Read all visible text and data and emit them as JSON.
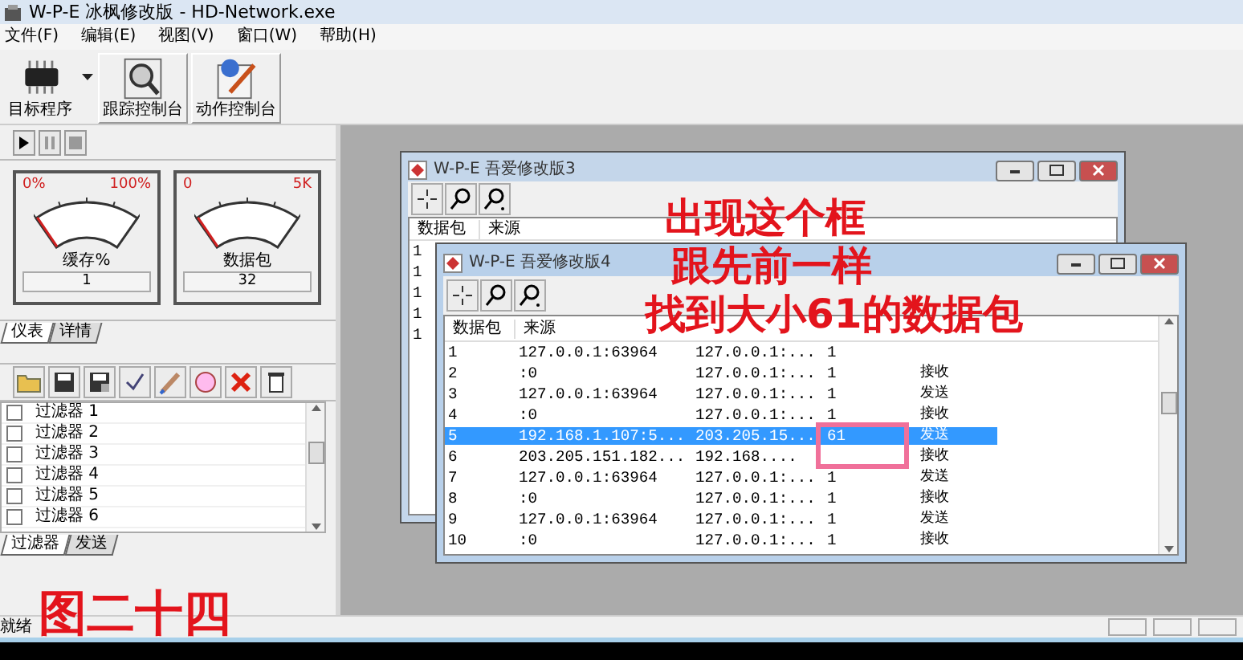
{
  "window": {
    "title": "W-P-E 冰枫修改版 - HD-Network.exe"
  },
  "menu": [
    "文件(F)",
    "编辑(E)",
    "视图(V)",
    "窗口(W)",
    "帮助(H)"
  ],
  "toolbar": [
    {
      "label": "目标程序",
      "kind": "target"
    },
    {
      "label": "跟踪控制台",
      "kind": "trace"
    },
    {
      "label": "动作控制台",
      "kind": "action"
    }
  ],
  "left_panel": {
    "gauges": [
      {
        "min_label": "0%",
        "max_label": "100%",
        "title": "缓存%",
        "value": "1"
      },
      {
        "min_label": "0",
        "max_label": "5K",
        "title": "数据包",
        "value": "32"
      }
    ],
    "gauge_tabs": [
      {
        "label": "仪表",
        "selected": true
      },
      {
        "label": "详情",
        "selected": false
      }
    ],
    "filters": [
      {
        "label": "过滤器 1",
        "checked": false
      },
      {
        "label": "过滤器 2",
        "checked": false
      },
      {
        "label": "过滤器 3",
        "checked": false
      },
      {
        "label": "过滤器 4",
        "checked": false
      },
      {
        "label": "过滤器 5",
        "checked": false
      },
      {
        "label": "过滤器 6",
        "checked": false
      }
    ],
    "filter_tabs": [
      {
        "label": "过滤器",
        "selected": true
      },
      {
        "label": "发送",
        "selected": false
      }
    ]
  },
  "windows": [
    {
      "title": "W-P-E 吾爱修改版3",
      "columns": [
        "数据包",
        "来源"
      ],
      "rows": [
        {
          "number": "1"
        },
        {
          "number": "1"
        },
        {
          "number": "1"
        },
        {
          "number": "1"
        },
        {
          "number": "1"
        }
      ]
    },
    {
      "title": "W-P-E 吾爱修改版4",
      "columns": [
        "数据包",
        "来源"
      ],
      "rows": [
        {
          "number": "1",
          "source": "127.0.0.1:63964",
          "target": "127.0.0.1:...",
          "size": "1",
          "selected": false
        },
        {
          "number": "2",
          "source": ":0",
          "target": "127.0.0.1:...",
          "size": "1",
          "action": "接收",
          "selected": false
        },
        {
          "number": "3",
          "source": "127.0.0.1:63964",
          "target": "127.0.0.1:...",
          "size": "1",
          "action": "发送",
          "selected": false
        },
        {
          "number": "4",
          "source": ":0",
          "target": "127.0.0.1:...",
          "size": "1",
          "action": "接收",
          "selected": false
        },
        {
          "number": "5",
          "source": "192.168.1.107:5...",
          "target": "203.205.15...",
          "size": "61",
          "action": "发送",
          "selected": true
        },
        {
          "number": "6",
          "source": "203.205.151.182...",
          "target": "192.168....",
          "action": "接收",
          "selected": false
        },
        {
          "number": "7",
          "source": "127.0.0.1:63964",
          "target": "127.0.0.1:...",
          "size": "1",
          "action": "发送",
          "selected": false
        },
        {
          "number": "8",
          "source": ":0",
          "target": "127.0.0.1:...",
          "size": "1",
          "action": "接收",
          "selected": false
        },
        {
          "number": "9",
          "source": "127.0.0.1:63964",
          "target": "127.0.0.1:...",
          "size": "1",
          "action": "发送",
          "selected": false
        },
        {
          "number": "10",
          "source": ":0",
          "target": "127.0.0.1:...",
          "size": "1",
          "action": "接收",
          "selected": false
        }
      ]
    }
  ],
  "status_bar": {
    "text": "就绪"
  },
  "annotations": [
    {
      "kind": "callout",
      "lines": [
        "出现这个框",
        "跟先前一样",
        "找到大小61的数据包"
      ]
    },
    {
      "kind": "highlight"
    },
    {
      "kind": "caption",
      "text": "图二十四"
    }
  ]
}
